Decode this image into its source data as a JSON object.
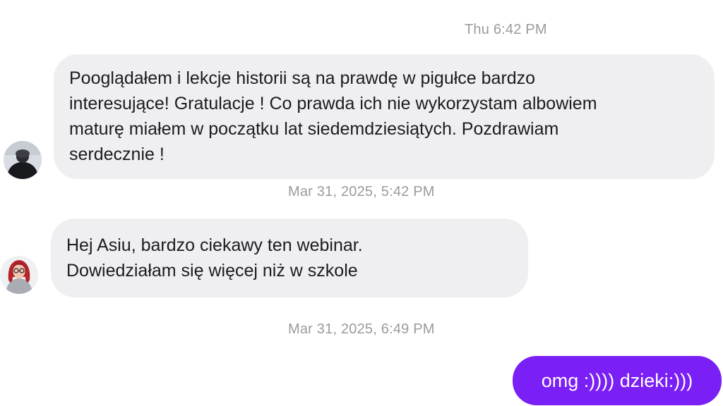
{
  "conversation": {
    "timestamps": [
      "Thu 6:42 PM",
      "Mar 31, 2025, 5:42 PM",
      "Mar 31, 2025, 6:49 PM"
    ],
    "messages": [
      {
        "direction": "incoming",
        "lines": [
          "Pooglądałem i lekcje historii są na prawdę w pigułce bardzo",
          "interesujące! Gratulacje ! Co prawda ich nie wykorzystam albowiem",
          "maturę miałem w początku lat siedemdziesiątych. Pozdrawiam",
          "serdecznie !"
        ]
      },
      {
        "direction": "incoming",
        "lines": [
          "Hej Asiu, bardzo ciekawy ten webinar.",
          "Dowiedziałam się więcej niż w szkole"
        ]
      },
      {
        "direction": "outgoing",
        "text": "omg :)))) dzieki:)))"
      }
    ]
  },
  "colors": {
    "incoming_bubble": "#efeff1",
    "outgoing_bubble": "#7a1ff5",
    "timestamp_text": "#9b9ba0"
  }
}
